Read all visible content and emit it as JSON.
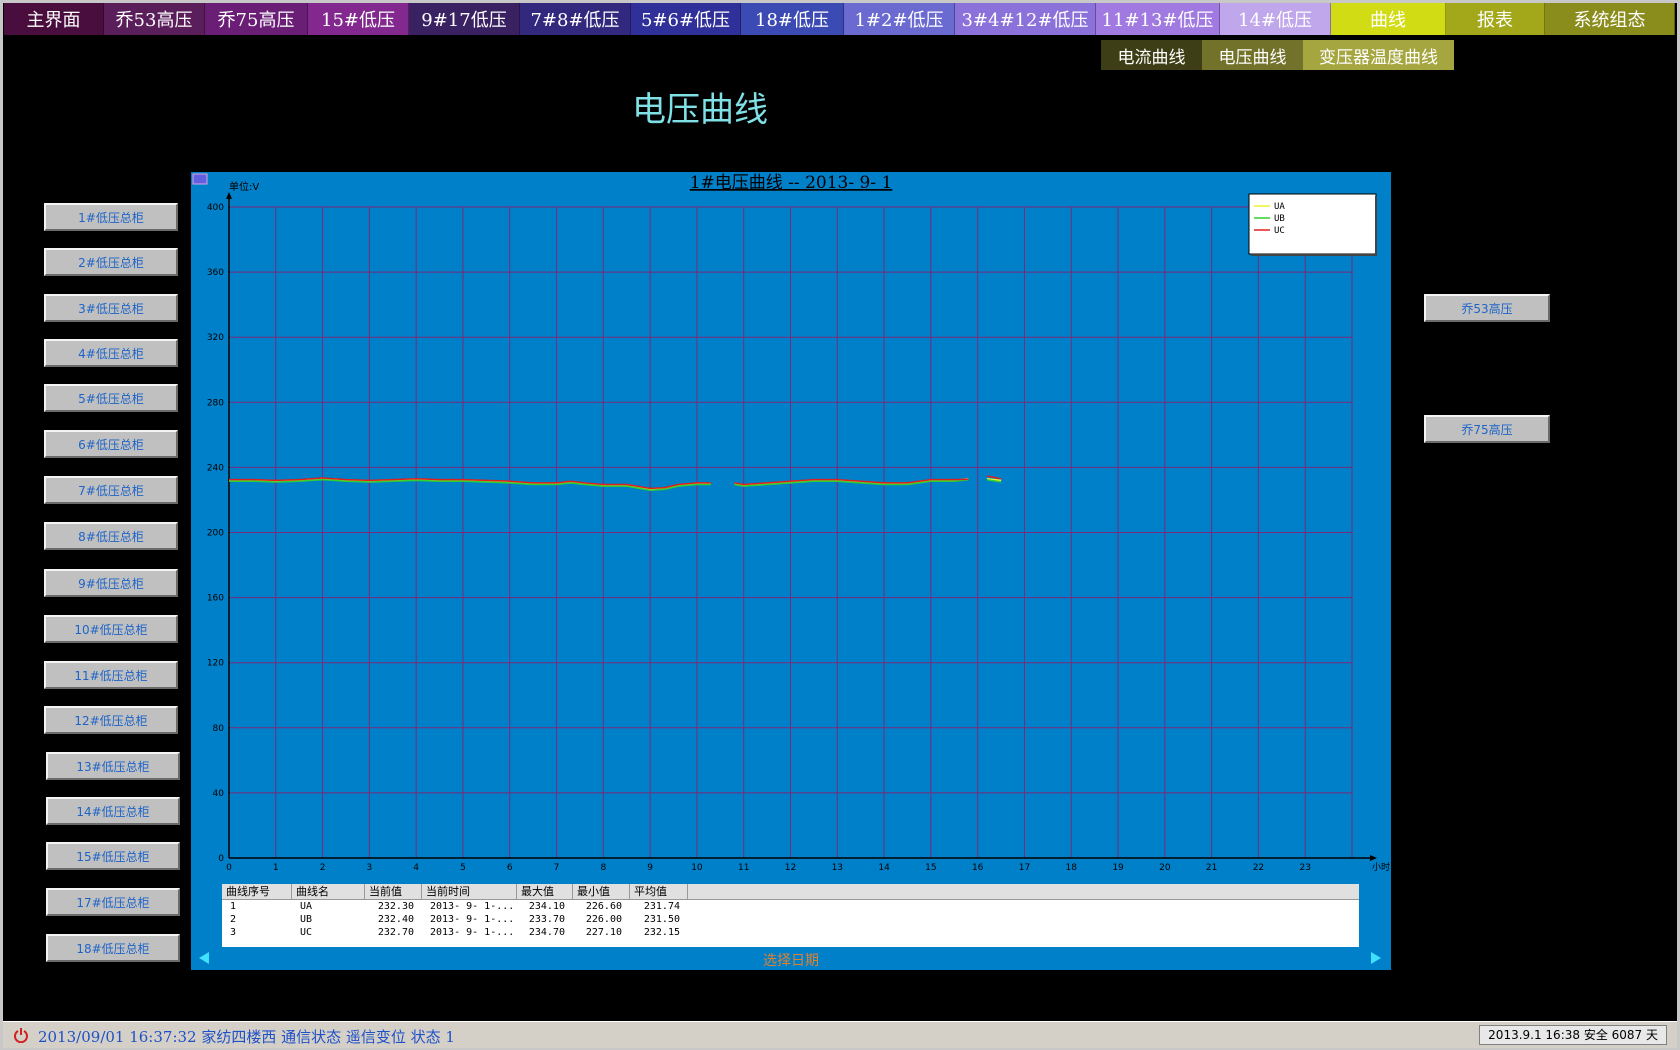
{
  "topnav": [
    {
      "label": "主界面",
      "color": "#4a0e3e",
      "width": 100
    },
    {
      "label": "乔53高压",
      "color": "#5a1e5a",
      "width": 101
    },
    {
      "label": "乔75高压",
      "color": "#6a1e76",
      "width": 103
    },
    {
      "label": "15#低压",
      "color": "#82288e",
      "width": 101
    },
    {
      "label": "9#17低压",
      "color": "#3a2262",
      "width": 111
    },
    {
      "label": "7#8#低压",
      "color": "#32287e",
      "width": 111
    },
    {
      "label": "5#6#低压",
      "color": "#30309a",
      "width": 110
    },
    {
      "label": "18#低压",
      "color": "#3c4ab4",
      "width": 103
    },
    {
      "label": "1#2#低压",
      "color": "#6a6ad0",
      "width": 111
    },
    {
      "label": "3#4#12#低压",
      "color": "#8a72da",
      "width": 141
    },
    {
      "label": "11#13#低压",
      "color": "#a07ae0",
      "width": 124
    },
    {
      "label": "14#低压",
      "color": "#c0a6ea",
      "width": 111
    },
    {
      "label": "曲线",
      "color": "#d2dc14",
      "width": 115
    },
    {
      "label": "报表",
      "color": "#a2a81a",
      "width": 99
    },
    {
      "label": "系统组态",
      "color": "#8a8c1c",
      "width": 130
    }
  ],
  "subnav": [
    {
      "label": "电流曲线",
      "color": "#3e3e16",
      "width": 101
    },
    {
      "label": "电压曲线",
      "color": "#72722a",
      "width": 101
    },
    {
      "label": "变压器温度曲线",
      "color": "#a6a640",
      "width": 151
    }
  ],
  "page_title": "电压曲线",
  "left_buttons": [
    "1#低压总柜",
    "2#低压总柜",
    "3#低压总柜",
    "4#低压总柜",
    "5#低压总柜",
    "6#低压总柜",
    "7#低压总柜",
    "8#低压总柜",
    "9#低压总柜",
    "10#低压总柜",
    "11#低压总柜",
    "12#低压总柜",
    "13#低压总柜",
    "14#低压总柜",
    "15#低压总柜",
    "17#低压总柜",
    "18#低压总柜"
  ],
  "right_buttons": [
    "乔53高压",
    "乔75高压"
  ],
  "chart_data": {
    "type": "line",
    "title": "1#电压曲线 -- 2013- 9- 1",
    "ylabel": "单位:V",
    "xlabel": "小时",
    "xlim": [
      0,
      24
    ],
    "ylim": [
      0,
      400
    ],
    "x_ticks": [
      0,
      1,
      2,
      3,
      4,
      5,
      6,
      7,
      8,
      9,
      10,
      11,
      12,
      13,
      14,
      15,
      16,
      17,
      18,
      19,
      20,
      21,
      22,
      23
    ],
    "y_ticks": [
      0,
      40,
      80,
      120,
      160,
      200,
      240,
      280,
      320,
      360,
      400
    ],
    "grid": true,
    "legend_position": "top-right",
    "x": [
      0,
      0.5,
      1,
      1.5,
      2,
      2.5,
      3,
      3.5,
      4,
      4.5,
      5,
      5.5,
      6,
      6.5,
      7,
      7.3,
      7.6,
      8,
      8.5,
      9,
      9.3,
      9.6,
      10,
      10.3,
      null,
      10.8,
      11,
      11.5,
      12,
      12.5,
      13,
      13.5,
      14,
      14.5,
      15,
      15.5,
      15.8,
      null,
      16.2,
      16.5
    ],
    "series": [
      {
        "name": "UA",
        "color": "#f0f030",
        "values": [
          232,
          232,
          231.5,
          232,
          233,
          232,
          231.5,
          232,
          232.5,
          232,
          232,
          231.5,
          231,
          230,
          230,
          231,
          230,
          229,
          229,
          226.6,
          227,
          229,
          230,
          230,
          null,
          230,
          229,
          230,
          231,
          232,
          232,
          231,
          230,
          230,
          232,
          232,
          233,
          null,
          233,
          232
        ]
      },
      {
        "name": "UB",
        "color": "#30d030",
        "values": [
          231.5,
          231.5,
          231,
          231.5,
          232.5,
          231.5,
          231,
          231.5,
          232,
          231.5,
          231.5,
          231,
          230.5,
          229.5,
          229.5,
          230.5,
          229.5,
          228.5,
          228.5,
          226,
          226.5,
          228.5,
          229.5,
          229.5,
          null,
          229.5,
          228.5,
          229.5,
          230.5,
          231.5,
          231.5,
          230.5,
          229.5,
          229.5,
          231.5,
          231.5,
          232.4,
          null,
          232.4,
          231
        ]
      },
      {
        "name": "UC",
        "color": "#e02020",
        "values": [
          232.5,
          232.5,
          232,
          232.5,
          233.5,
          232.5,
          232,
          232.5,
          233,
          232.5,
          232.5,
          232,
          231.5,
          230.5,
          230.5,
          231.5,
          230.5,
          229.5,
          229.5,
          227.1,
          227.5,
          229.5,
          230.5,
          230.5,
          null,
          230.5,
          229.5,
          230.5,
          231.5,
          232.5,
          232.5,
          231.5,
          230.5,
          230.5,
          232.5,
          232.5,
          232.7,
          null,
          234.7,
          233
        ]
      }
    ]
  },
  "table": {
    "headers": [
      "曲线序号",
      "曲线名",
      "当前值",
      "当前时间",
      "最大值",
      "最小值",
      "平均值"
    ],
    "rows": [
      [
        "1",
        "UA",
        "232.30",
        "2013- 9- 1-...",
        "234.10",
        "226.60",
        "231.74"
      ],
      [
        "2",
        "UB",
        "232.40",
        "2013- 9- 1-...",
        "233.70",
        "226.00",
        "231.50"
      ],
      [
        "3",
        "UC",
        "232.70",
        "2013- 9- 1-...",
        "234.70",
        "227.10",
        "232.15"
      ]
    ]
  },
  "date_label": "选择日期",
  "status": {
    "text": "2013/09/01 16:37:32 家纺四楼西 通信状态 遥信变位 状态 1",
    "right": "2013.9.1   16:38 安全 6087 天"
  }
}
